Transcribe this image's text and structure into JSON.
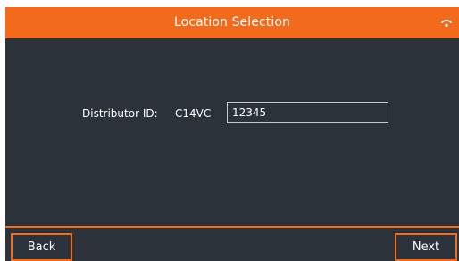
{
  "header": {
    "title": "Location Selection",
    "status_icon": "wifi-icon"
  },
  "form": {
    "label": "Distributor ID:",
    "code": "C14VC",
    "field_value": "12345"
  },
  "footer": {
    "back_label": "Back",
    "next_label": "Next"
  },
  "colors": {
    "accent": "#f26a1b",
    "background": "#2b3239",
    "text": "#ffffff",
    "field_border": "#c2cad2"
  }
}
